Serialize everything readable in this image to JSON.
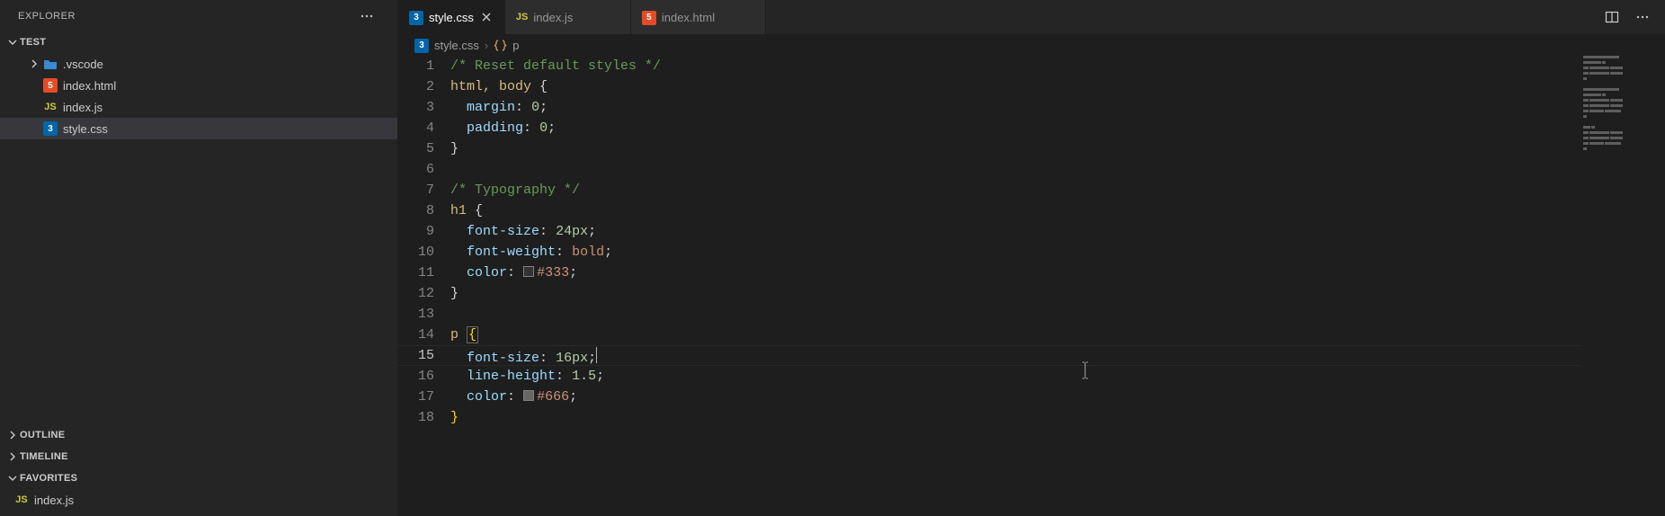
{
  "sidebar": {
    "title": "EXPLORER",
    "project": "TEST",
    "tree": [
      {
        "name": ".vscode",
        "type": "folder"
      },
      {
        "name": "index.html",
        "type": "html"
      },
      {
        "name": "index.js",
        "type": "js"
      },
      {
        "name": "style.css",
        "type": "css",
        "active": true
      }
    ],
    "sections": {
      "outline": "OUTLINE",
      "timeline": "TIMELINE",
      "favorites": "FAVORITES"
    },
    "favorites": [
      {
        "name": "index.js",
        "type": "js"
      }
    ]
  },
  "tabs": [
    {
      "name": "style.css",
      "type": "css",
      "active": true
    },
    {
      "name": "index.js",
      "type": "js"
    },
    {
      "name": "index.html",
      "type": "html"
    }
  ],
  "breadcrumb": {
    "file": "style.css",
    "symbol": "p"
  },
  "code": {
    "current_line": 15,
    "lines": [
      {
        "n": 1,
        "t": "comment",
        "text": "/* Reset default styles */"
      },
      {
        "n": 2,
        "t": "sel-open",
        "sel": "html, body",
        "brace": "{"
      },
      {
        "n": 3,
        "t": "decl",
        "prop": "margin",
        "val": "0",
        "valtype": "num"
      },
      {
        "n": 4,
        "t": "decl",
        "prop": "padding",
        "val": "0",
        "valtype": "num"
      },
      {
        "n": 5,
        "t": "close",
        "brace": "}"
      },
      {
        "n": 6,
        "t": "blank"
      },
      {
        "n": 7,
        "t": "comment",
        "text": "/* Typography */"
      },
      {
        "n": 8,
        "t": "sel-open",
        "sel": "h1",
        "brace": "{"
      },
      {
        "n": 9,
        "t": "decl",
        "prop": "font-size",
        "val": "24px",
        "valtype": "num"
      },
      {
        "n": 10,
        "t": "decl",
        "prop": "font-weight",
        "val": "bold",
        "valtype": "val"
      },
      {
        "n": 11,
        "t": "decl-color",
        "prop": "color",
        "val": "#333",
        "swatch": "#333333"
      },
      {
        "n": 12,
        "t": "close",
        "brace": "}"
      },
      {
        "n": 13,
        "t": "blank"
      },
      {
        "n": 14,
        "t": "sel-open-match",
        "sel": "p",
        "brace": "{"
      },
      {
        "n": 15,
        "t": "decl",
        "prop": "font-size",
        "val": "16px",
        "valtype": "num",
        "caret": true
      },
      {
        "n": 16,
        "t": "decl",
        "prop": "line-height",
        "val": "1.5",
        "valtype": "num"
      },
      {
        "n": 17,
        "t": "decl-color",
        "prop": "color",
        "val": "#666",
        "swatch": "#666666"
      },
      {
        "n": 18,
        "t": "close-match",
        "brace": "}"
      }
    ]
  }
}
